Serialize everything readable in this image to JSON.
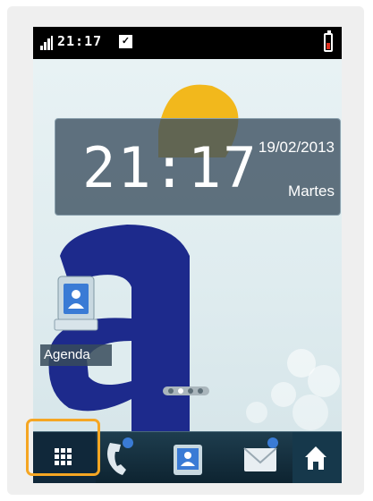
{
  "status_bar": {
    "time": "21:17",
    "signal_icon": "signal-bars-icon",
    "notification_icon": "message-check-icon",
    "battery_icon": "battery-low-icon"
  },
  "clock_widget": {
    "time": "21:17",
    "date": "19/02/2013",
    "weekday": "Martes"
  },
  "desktop_icons": [
    {
      "label": "Agenda",
      "icon": "contacts-icon"
    }
  ],
  "dock": {
    "items": [
      {
        "icon": "app-menu-grid-icon",
        "selected": true
      },
      {
        "icon": "phone-icon"
      },
      {
        "icon": "contacts-icon"
      },
      {
        "icon": "messages-icon"
      },
      {
        "icon": "home-icon"
      }
    ]
  },
  "colors": {
    "highlight": "#f5a623",
    "logo_blue": "#1d2a8c",
    "logo_yellow": "#f2b81c",
    "widget_bg": "#3c5060"
  }
}
